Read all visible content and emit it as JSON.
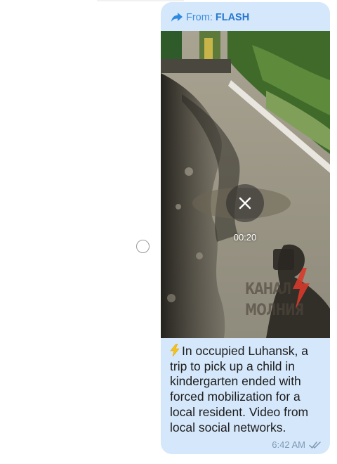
{
  "message": {
    "forward_prefix": "From:",
    "forward_source": "FLASH",
    "video": {
      "duration": "00:20",
      "watermark_line1": "КАНАЛ",
      "watermark_line2": "МОЛНИЯ"
    },
    "caption_emoji": "⚡",
    "caption": "In occupied Luhansk, a trip to pick up a child in kindergarten ended with forced mobilization for a local resident. Video from local social networks.",
    "time": "6:42 AM",
    "status_icon": "double-check-icon"
  },
  "colors": {
    "bubble": "#d5e7fa",
    "link": "#2e8ae0",
    "meta": "#7e9ab3",
    "text": "#1c1c1c"
  }
}
